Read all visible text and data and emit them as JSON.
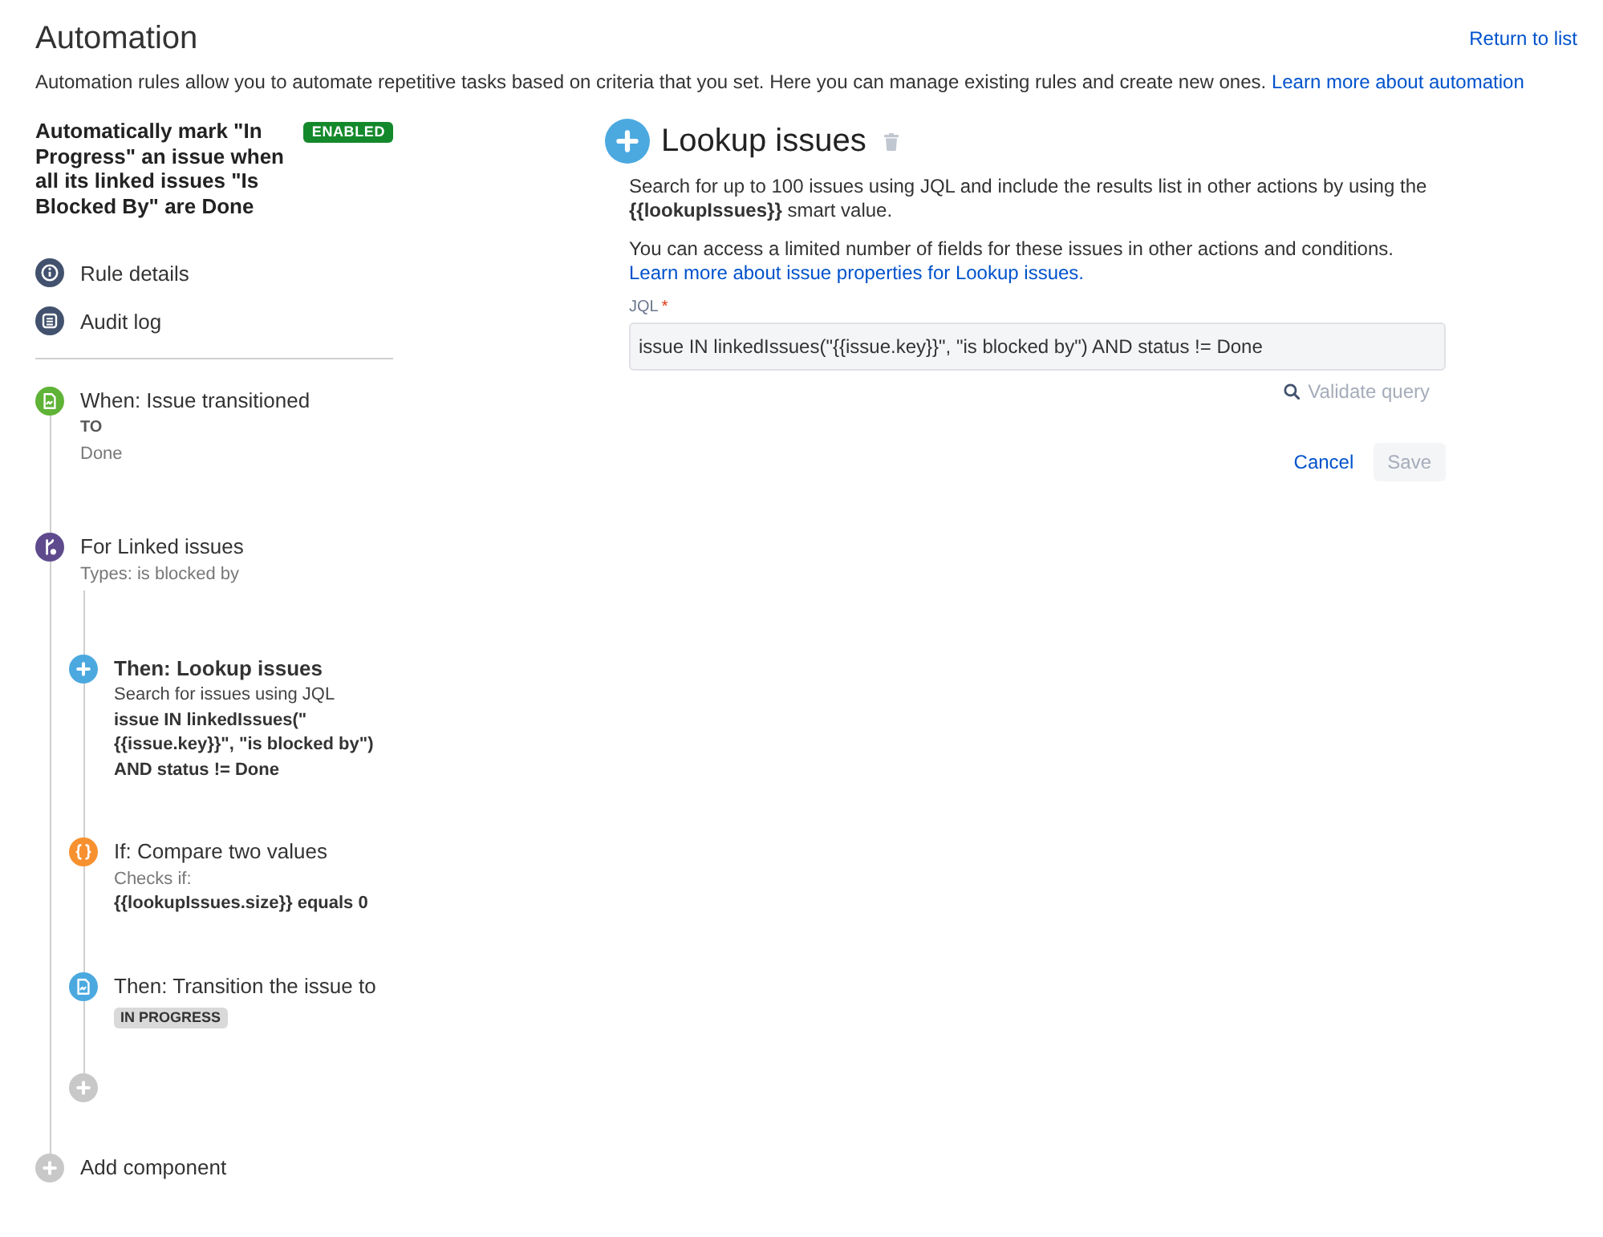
{
  "header": {
    "title": "Automation",
    "return_link": "Return to list",
    "description": "Automation rules allow you to automate repetitive tasks based on criteria that you set. Here you can manage existing rules and create new ones.",
    "description_link": "Learn more about automation"
  },
  "rule": {
    "name": "Automatically mark \"In Progress\" an issue when all its linked issues \"Is Blocked By\" are Done",
    "status_label": "ENABLED",
    "enabled": true
  },
  "rule_nav": [
    {
      "kind": "details",
      "label": "Rule details"
    },
    {
      "kind": "audit",
      "label": "Audit log"
    }
  ],
  "components": [
    {
      "kind": "trigger",
      "title": "When: Issue transitioned",
      "selected": false,
      "details": [
        {
          "kind": "label",
          "text": "TO"
        },
        {
          "kind": "value",
          "text": "Done"
        }
      ]
    },
    {
      "kind": "branch",
      "title": "For Linked issues",
      "selected": false,
      "details": [
        {
          "kind": "value",
          "text": "Types: is blocked by"
        }
      ],
      "children": [
        {
          "kind": "lookup",
          "title": "Then: Lookup issues",
          "selected": true,
          "details": [
            {
              "kind": "text",
              "text": "Search for issues using JQL"
            },
            {
              "kind": "code",
              "text": "issue IN linkedIssues(\"{{issue.key}}\", \"is blocked by\") AND status != Done"
            }
          ]
        },
        {
          "kind": "condition",
          "title": "If: Compare two values",
          "selected": false,
          "details": [
            {
              "kind": "value",
              "text": "Checks if:"
            },
            {
              "kind": "code",
              "text": "{{lookupIssues.size}} equals 0"
            }
          ]
        },
        {
          "kind": "transition",
          "title": "Then: Transition the issue to",
          "selected": false,
          "details": [
            {
              "kind": "lozenge",
              "text": "IN PROGRESS"
            }
          ]
        }
      ]
    }
  ],
  "add_component": "Add component",
  "editor": {
    "title": "Lookup issues",
    "intro": "Search for up to 100 issues using JQL and include the results list in other actions by using the **{{lookupIssues}}** smart value.",
    "note": "You can access a limited number of fields for these issues in other actions and conditions.",
    "note_link": "Learn more about issue properties for Lookup issues.",
    "field": {
      "label": "JQL",
      "required_mark": "*",
      "value": "issue IN linkedIssues(\"{{issue.key}}\", \"is blocked by\") AND status != Done"
    },
    "validate": {
      "label": "Validate query",
      "disabled": true
    },
    "actions": [
      {
        "kind": "link",
        "label": "Cancel",
        "disabled": false
      },
      {
        "kind": "button",
        "label": "Save",
        "disabled": true
      }
    ]
  }
}
